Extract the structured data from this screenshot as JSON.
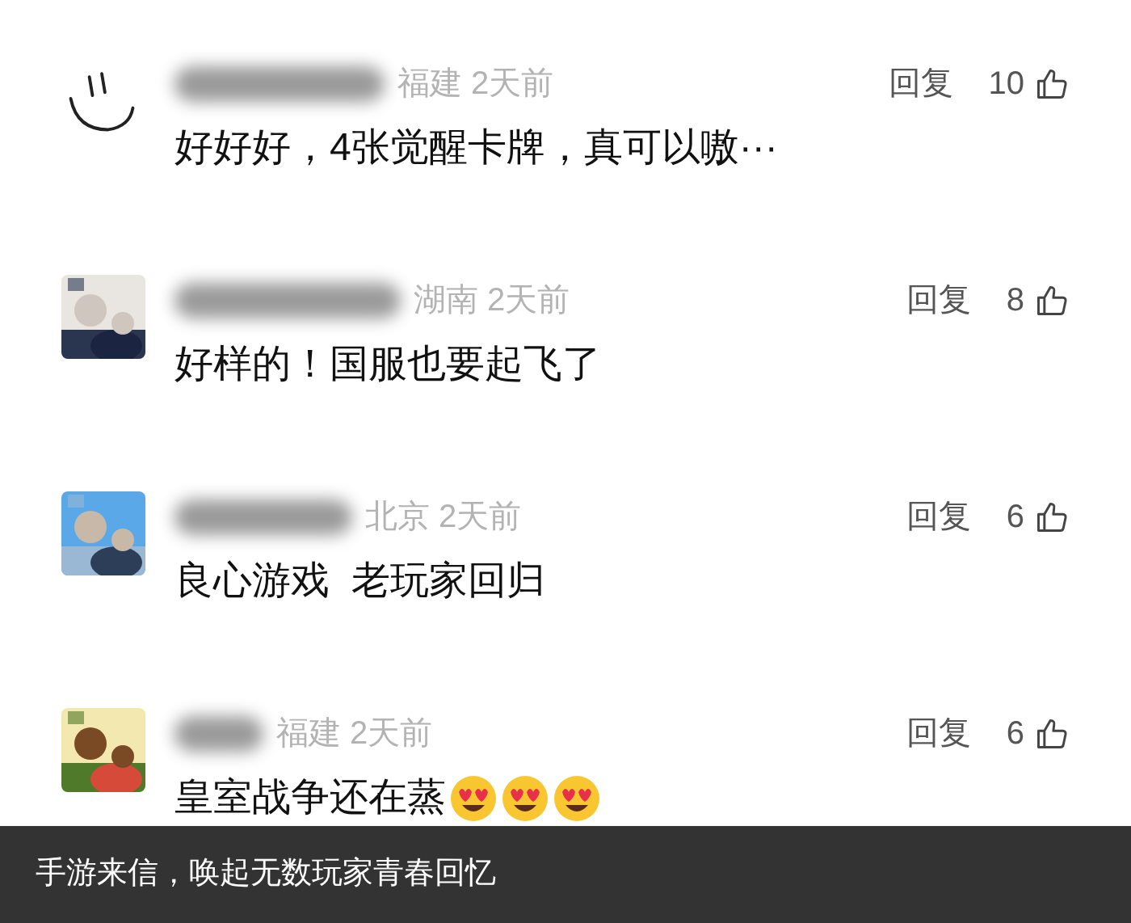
{
  "comments": [
    {
      "avatar": {
        "kind": "smiley"
      },
      "region": "福建",
      "time": "2天前",
      "reply": "回复",
      "likes": "10",
      "text": "好好好，4张觉醒卡牌，真可以嗷···"
    },
    {
      "avatar": {
        "kind": "picture"
      },
      "region": "湖南",
      "time": "2天前",
      "reply": "回复",
      "likes": "8",
      "text": "好样的！国服也要起飞了"
    },
    {
      "avatar": {
        "kind": "picture"
      },
      "region": "北京",
      "time": "2天前",
      "reply": "回复",
      "likes": "6",
      "text": "良心游戏  老玩家回归"
    },
    {
      "avatar": {
        "kind": "picture"
      },
      "region": "福建",
      "time": "2天前",
      "reply": "回复",
      "likes": "6",
      "text": "皇室战争还在蒸",
      "emojis": [
        {
          "kind": "heart-eyes"
        },
        {
          "kind": "heart-eyes"
        },
        {
          "kind": "heart-eyes"
        }
      ]
    }
  ],
  "caption": "手游来信，唤起无数玩家青春回忆"
}
